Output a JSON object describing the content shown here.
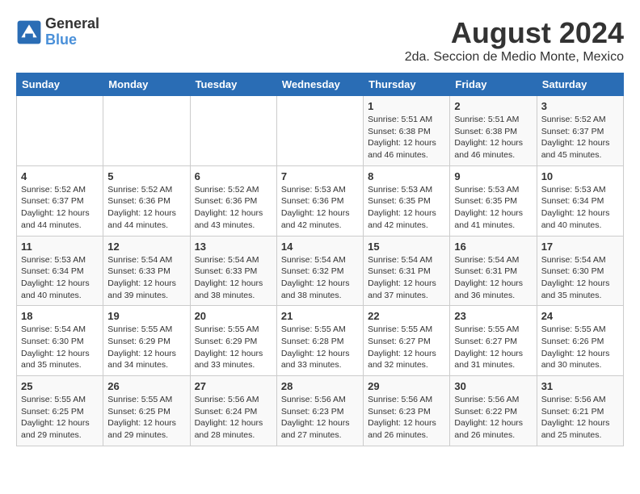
{
  "header": {
    "logo_general": "General",
    "logo_blue": "Blue",
    "title": "August 2024",
    "subtitle": "2da. Seccion de Medio Monte, Mexico"
  },
  "calendar": {
    "days_of_week": [
      "Sunday",
      "Monday",
      "Tuesday",
      "Wednesday",
      "Thursday",
      "Friday",
      "Saturday"
    ],
    "weeks": [
      [
        {
          "day": "",
          "info": ""
        },
        {
          "day": "",
          "info": ""
        },
        {
          "day": "",
          "info": ""
        },
        {
          "day": "",
          "info": ""
        },
        {
          "day": "1",
          "info": "Sunrise: 5:51 AM\nSunset: 6:38 PM\nDaylight: 12 hours\nand 46 minutes."
        },
        {
          "day": "2",
          "info": "Sunrise: 5:51 AM\nSunset: 6:38 PM\nDaylight: 12 hours\nand 46 minutes."
        },
        {
          "day": "3",
          "info": "Sunrise: 5:52 AM\nSunset: 6:37 PM\nDaylight: 12 hours\nand 45 minutes."
        }
      ],
      [
        {
          "day": "4",
          "info": "Sunrise: 5:52 AM\nSunset: 6:37 PM\nDaylight: 12 hours\nand 44 minutes."
        },
        {
          "day": "5",
          "info": "Sunrise: 5:52 AM\nSunset: 6:36 PM\nDaylight: 12 hours\nand 44 minutes."
        },
        {
          "day": "6",
          "info": "Sunrise: 5:52 AM\nSunset: 6:36 PM\nDaylight: 12 hours\nand 43 minutes."
        },
        {
          "day": "7",
          "info": "Sunrise: 5:53 AM\nSunset: 6:36 PM\nDaylight: 12 hours\nand 42 minutes."
        },
        {
          "day": "8",
          "info": "Sunrise: 5:53 AM\nSunset: 6:35 PM\nDaylight: 12 hours\nand 42 minutes."
        },
        {
          "day": "9",
          "info": "Sunrise: 5:53 AM\nSunset: 6:35 PM\nDaylight: 12 hours\nand 41 minutes."
        },
        {
          "day": "10",
          "info": "Sunrise: 5:53 AM\nSunset: 6:34 PM\nDaylight: 12 hours\nand 40 minutes."
        }
      ],
      [
        {
          "day": "11",
          "info": "Sunrise: 5:53 AM\nSunset: 6:34 PM\nDaylight: 12 hours\nand 40 minutes."
        },
        {
          "day": "12",
          "info": "Sunrise: 5:54 AM\nSunset: 6:33 PM\nDaylight: 12 hours\nand 39 minutes."
        },
        {
          "day": "13",
          "info": "Sunrise: 5:54 AM\nSunset: 6:33 PM\nDaylight: 12 hours\nand 38 minutes."
        },
        {
          "day": "14",
          "info": "Sunrise: 5:54 AM\nSunset: 6:32 PM\nDaylight: 12 hours\nand 38 minutes."
        },
        {
          "day": "15",
          "info": "Sunrise: 5:54 AM\nSunset: 6:31 PM\nDaylight: 12 hours\nand 37 minutes."
        },
        {
          "day": "16",
          "info": "Sunrise: 5:54 AM\nSunset: 6:31 PM\nDaylight: 12 hours\nand 36 minutes."
        },
        {
          "day": "17",
          "info": "Sunrise: 5:54 AM\nSunset: 6:30 PM\nDaylight: 12 hours\nand 35 minutes."
        }
      ],
      [
        {
          "day": "18",
          "info": "Sunrise: 5:54 AM\nSunset: 6:30 PM\nDaylight: 12 hours\nand 35 minutes."
        },
        {
          "day": "19",
          "info": "Sunrise: 5:55 AM\nSunset: 6:29 PM\nDaylight: 12 hours\nand 34 minutes."
        },
        {
          "day": "20",
          "info": "Sunrise: 5:55 AM\nSunset: 6:29 PM\nDaylight: 12 hours\nand 33 minutes."
        },
        {
          "day": "21",
          "info": "Sunrise: 5:55 AM\nSunset: 6:28 PM\nDaylight: 12 hours\nand 33 minutes."
        },
        {
          "day": "22",
          "info": "Sunrise: 5:55 AM\nSunset: 6:27 PM\nDaylight: 12 hours\nand 32 minutes."
        },
        {
          "day": "23",
          "info": "Sunrise: 5:55 AM\nSunset: 6:27 PM\nDaylight: 12 hours\nand 31 minutes."
        },
        {
          "day": "24",
          "info": "Sunrise: 5:55 AM\nSunset: 6:26 PM\nDaylight: 12 hours\nand 30 minutes."
        }
      ],
      [
        {
          "day": "25",
          "info": "Sunrise: 5:55 AM\nSunset: 6:25 PM\nDaylight: 12 hours\nand 29 minutes."
        },
        {
          "day": "26",
          "info": "Sunrise: 5:55 AM\nSunset: 6:25 PM\nDaylight: 12 hours\nand 29 minutes."
        },
        {
          "day": "27",
          "info": "Sunrise: 5:56 AM\nSunset: 6:24 PM\nDaylight: 12 hours\nand 28 minutes."
        },
        {
          "day": "28",
          "info": "Sunrise: 5:56 AM\nSunset: 6:23 PM\nDaylight: 12 hours\nand 27 minutes."
        },
        {
          "day": "29",
          "info": "Sunrise: 5:56 AM\nSunset: 6:23 PM\nDaylight: 12 hours\nand 26 minutes."
        },
        {
          "day": "30",
          "info": "Sunrise: 5:56 AM\nSunset: 6:22 PM\nDaylight: 12 hours\nand 26 minutes."
        },
        {
          "day": "31",
          "info": "Sunrise: 5:56 AM\nSunset: 6:21 PM\nDaylight: 12 hours\nand 25 minutes."
        }
      ]
    ]
  }
}
